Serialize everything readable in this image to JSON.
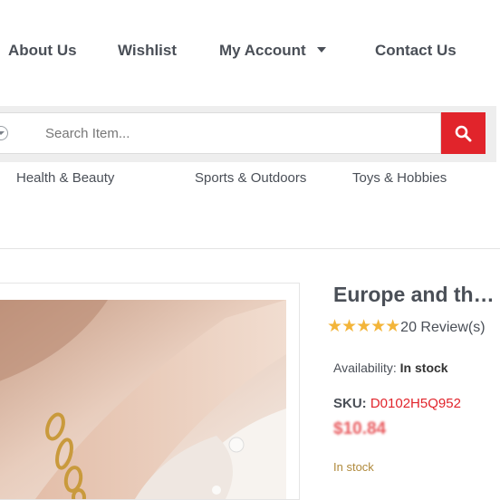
{
  "top_nav": {
    "about_us": "About Us",
    "wishlist": "Wishlist",
    "my_account": "My Account",
    "contact_us": "Contact Us"
  },
  "search": {
    "placeholder": "Search Item...",
    "button_icon": "search-icon"
  },
  "categories": [
    "Health & Beauty",
    "Sports & Outdoors",
    "Toys & Hobbies"
  ],
  "product": {
    "title": "Europe and the ...",
    "rating": 5,
    "stars": "★★★★★",
    "reviews": "20 Review(s)",
    "availability_label": "Availability:",
    "availability_value": "In stock",
    "sku_label": "SKU:",
    "sku_value": "D0102H5Q952",
    "price": "$10.84",
    "stock_status": "In stock"
  },
  "colors": {
    "accent": "#e1242b",
    "star": "#f3b53a",
    "nav_text": "#4a4f57"
  }
}
